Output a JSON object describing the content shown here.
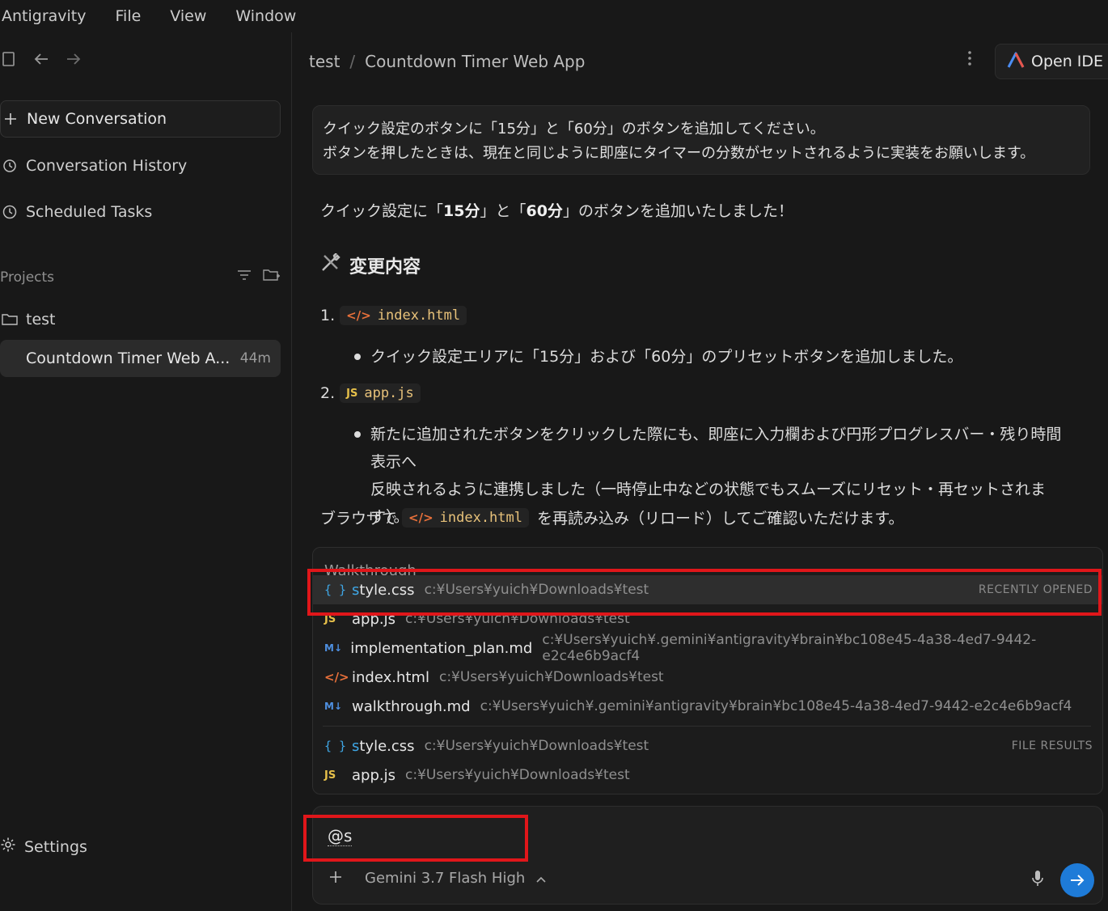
{
  "menubar": {
    "app": "Antigravity",
    "items": [
      "File",
      "View",
      "Window"
    ]
  },
  "sidebar": {
    "new_conversation": "New Conversation",
    "history": "Conversation History",
    "scheduled": "Scheduled Tasks",
    "projects_label": "Projects",
    "project_name": "test",
    "active_conversation": "Countdown Timer Web A...",
    "active_time": "44m",
    "settings": "Settings"
  },
  "header": {
    "crumb_project": "test",
    "crumb_sep": "/",
    "crumb_title": "Countdown Timer Web App",
    "open_ide": "Open IDE"
  },
  "user_message": {
    "line1": "クイック設定のボタンに「15分」と「60分」のボタンを追加してください。",
    "line2": "ボタンを押したときは、現在と同じように即座にタイマーの分数がセットされるように実装をお願いします。"
  },
  "response": {
    "intro_pre": "クイック設定に「",
    "intro_b1": "15分",
    "intro_mid": "」と「",
    "intro_b2": "60分",
    "intro_post": "」のボタンを追加いたしました！",
    "section_title": "変更内容",
    "item1_num": "1.",
    "item1_file": "index.html",
    "item1_bullet": "クイック設定エリアに「15分」および「60分」のプリセットボタンを追加しました。",
    "item2_num": "2.",
    "item2_file": "app.js",
    "item2_bullet_l1": "新たに追加されたボタンをクリックした際にも、即座に入力欄および円形プログレスバー・残り時間表示へ",
    "item2_bullet_l2": "反映されるように連携しました（一時停止中などの状態でもスムーズにリセット・再セットされます）。",
    "closing_pre": "ブラウザで",
    "closing_file": "index.html",
    "closing_post": "を再読み込み（リロード）してご確認いただけます。"
  },
  "popup": {
    "peek": "Walkthrough",
    "recent_tag": "RECENTLY OPENED",
    "file_tag": "FILE RESULTS",
    "recent": [
      {
        "icon": "css-icon",
        "name_hl": "s",
        "name_rest": "tyle.css",
        "path": "c:¥Users¥yuich¥Downloads¥test"
      },
      {
        "icon": "js-icon",
        "name_hl": "",
        "name_rest": "app.js",
        "path": "c:¥Users¥yuich¥Downloads¥test"
      },
      {
        "icon": "markdown-icon",
        "name_hl": "",
        "name_rest": "implementation_plan.md",
        "path": "c:¥Users¥yuich¥.gemini¥antigravity¥brain¥bc108e45-4a38-4ed7-9442-e2c4e6b9acf4"
      },
      {
        "icon": "html-icon",
        "name_hl": "",
        "name_rest": "index.html",
        "path": "c:¥Users¥yuich¥Downloads¥test"
      },
      {
        "icon": "markdown-icon",
        "name_hl": "",
        "name_rest": "walkthrough.md",
        "path": "c:¥Users¥yuich¥.gemini¥antigravity¥brain¥bc108e45-4a38-4ed7-9442-e2c4e6b9acf4"
      }
    ],
    "files": [
      {
        "icon": "css-icon",
        "name_hl": "s",
        "name_rest": "tyle.css",
        "path": "c:¥Users¥yuich¥Downloads¥test"
      },
      {
        "icon": "js-icon",
        "name_hl": "",
        "name_rest": "app.js",
        "path": "c:¥Users¥yuich¥Downloads¥test"
      }
    ]
  },
  "composer": {
    "input_value": "@s",
    "model": "Gemini 3.7 Flash High"
  },
  "colors": {
    "accent": "#1e7bd8",
    "highlight_box": "#e0161a",
    "code_file": "#e8c27a"
  }
}
